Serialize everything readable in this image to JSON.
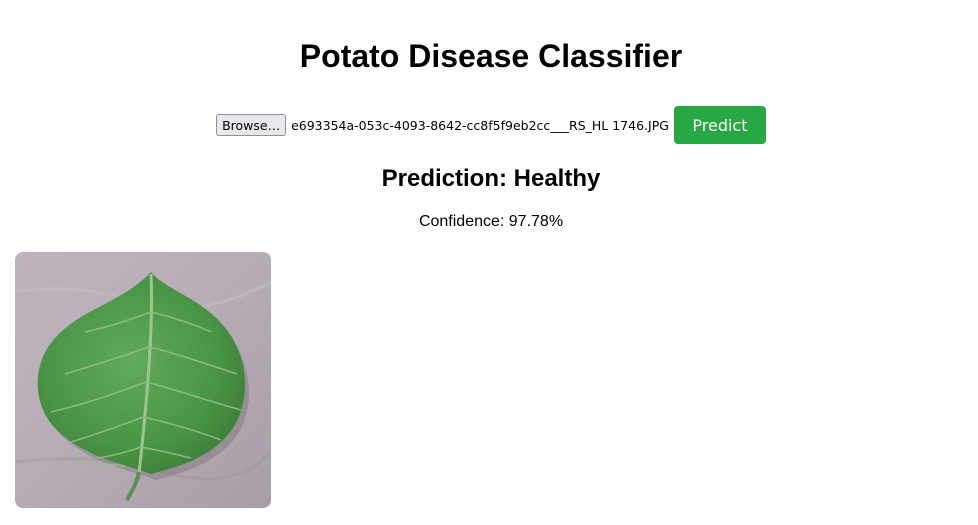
{
  "app": {
    "title": "Potato Disease Classifier"
  },
  "upload": {
    "browse_label": "Browse…",
    "file_name": "e693354a-053c-4093-8642-cc8f5f9eb2cc___RS_HL 1746.JPG",
    "predict_label": "Predict"
  },
  "result": {
    "prediction_text": "Prediction: Healthy",
    "confidence_text": "Confidence: 97.78%"
  },
  "colors": {
    "predict_button": "#28a745",
    "leaf": "#4f9a4c",
    "background_surface": "#b9aeb6"
  },
  "image": {
    "subject": "healthy potato leaf"
  }
}
